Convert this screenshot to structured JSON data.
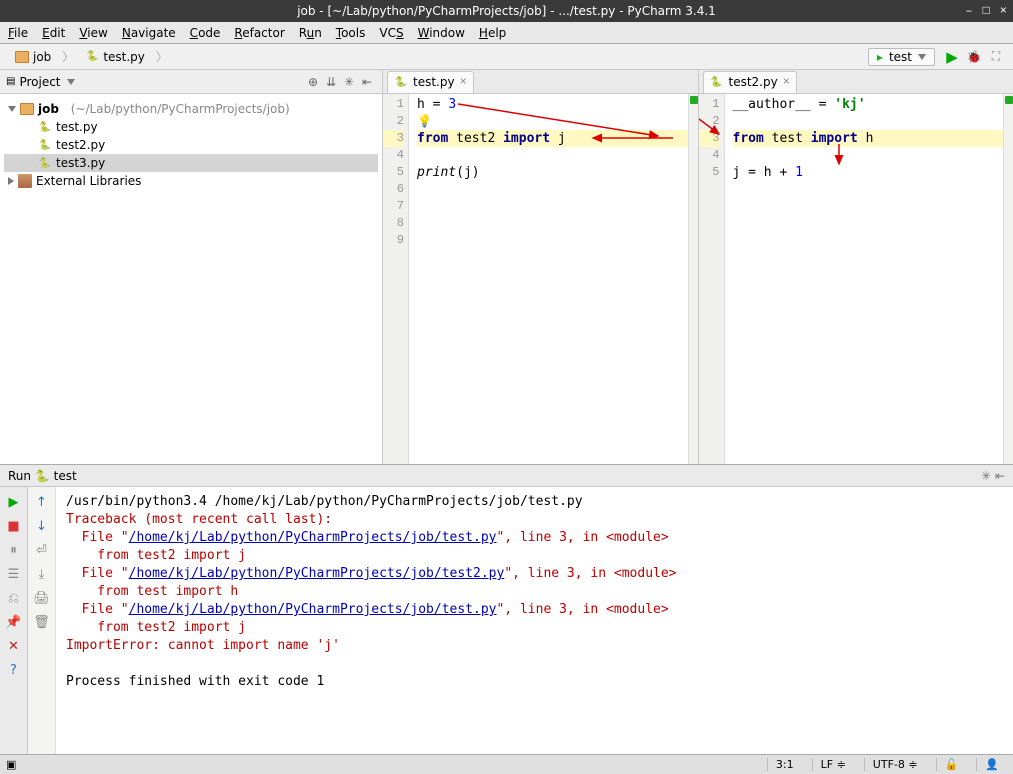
{
  "title": "job - [~/Lab/python/PyCharmProjects/job] - .../test.py - PyCharm 3.4.1",
  "menu": [
    "File",
    "Edit",
    "View",
    "Navigate",
    "Code",
    "Refactor",
    "Run",
    "Tools",
    "VCS",
    "Window",
    "Help"
  ],
  "breadcrumb": {
    "root": "job",
    "file": "test.py"
  },
  "run_config": "test",
  "project": {
    "title": "Project",
    "root": "job",
    "root_path": "(~/Lab/python/PyCharmProjects/job)",
    "files": [
      "test.py",
      "test2.py",
      "test3.py"
    ],
    "selected": "test3.py",
    "ext": "External Libraries"
  },
  "editor1": {
    "tab": "test.py",
    "lines": [
      "1",
      "2",
      "3",
      "4",
      "5",
      "6",
      "7",
      "8",
      "9"
    ],
    "l1_a": "h = ",
    "l1_b": "3",
    "l3_a": "from",
    "l3_b": " test2 ",
    "l3_c": "import",
    "l3_d": " j",
    "l5_a": "print",
    "l5_b": "(j)"
  },
  "editor2": {
    "tab": "test2.py",
    "lines": [
      "1",
      "2",
      "3",
      "4",
      "5"
    ],
    "l1_a": "__author__ = ",
    "l1_b": "'kj'",
    "l3_a": "from",
    "l3_b": " test ",
    "l3_c": "import",
    "l3_d": " h",
    "l5_a": "j = h + ",
    "l5_b": "1"
  },
  "run": {
    "label": "Run",
    "name": "test",
    "cmd": "/usr/bin/python3.4 /home/kj/Lab/python/PyCharmProjects/job/test.py",
    "tb": "Traceback (most recent call last):",
    "f1a": "  File \"",
    "f1l": "/home/kj/Lab/python/PyCharmProjects/job/test.py",
    "f1b": "\", line 3, in <module>",
    "f1s": "    from test2 import j",
    "f2a": "  File \"",
    "f2l": "/home/kj/Lab/python/PyCharmProjects/job/test2.py",
    "f2b": "\", line 3, in <module>",
    "f2s": "    from test import h",
    "f3a": "  File \"",
    "f3l": "/home/kj/Lab/python/PyCharmProjects/job/test.py",
    "f3b": "\", line 3, in <module>",
    "f3s": "    from test2 import j",
    "err": "ImportError: cannot import name 'j'",
    "exit": "Process finished with exit code 1"
  },
  "status": {
    "pos": "3:1",
    "le": "LF",
    "enc": "UTF-8"
  }
}
